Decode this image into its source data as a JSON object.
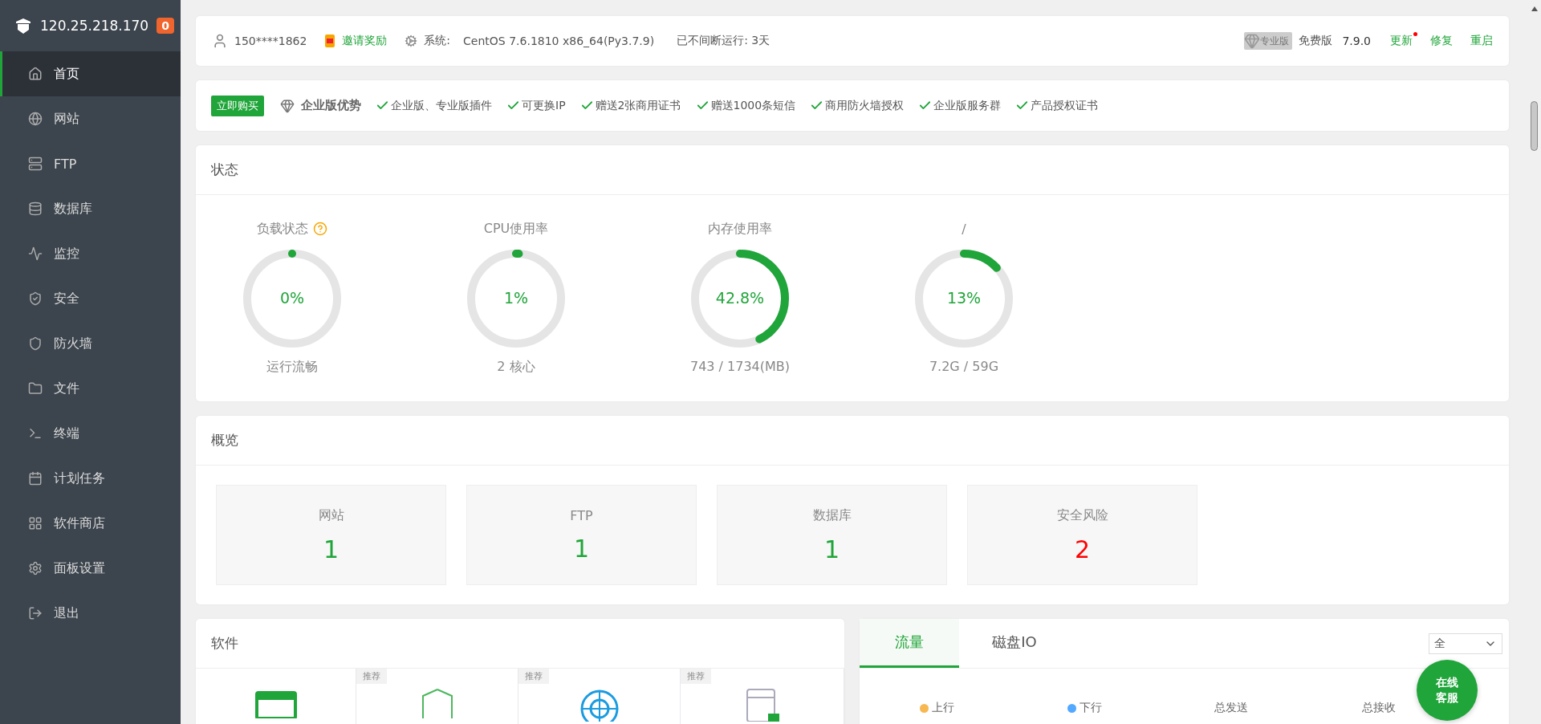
{
  "sidebar": {
    "host": "120.25.218.170",
    "badge": "0",
    "items": [
      {
        "label": "首页",
        "selected": true
      },
      {
        "label": "网站",
        "selected": false
      },
      {
        "label": "FTP",
        "selected": false
      },
      {
        "label": "数据库",
        "selected": false
      },
      {
        "label": "监控",
        "selected": false
      },
      {
        "label": "安全",
        "selected": false
      },
      {
        "label": "防火墙",
        "selected": false
      },
      {
        "label": "文件",
        "selected": false
      },
      {
        "label": "终端",
        "selected": false
      },
      {
        "label": "计划任务",
        "selected": false
      },
      {
        "label": "软件商店",
        "selected": false
      },
      {
        "label": "面板设置",
        "selected": false
      },
      {
        "label": "退出",
        "selected": false
      }
    ]
  },
  "topbar": {
    "user": "150****1862",
    "invite": "邀请奖励",
    "system_label": "系统:",
    "system": "CentOS 7.6.1810 x86_64(Py3.7.9)",
    "uptime": "已不间断运行: 3天",
    "pro_badge": "专业版",
    "edition": "免费版",
    "version": "7.9.0",
    "links": [
      {
        "label": "更新",
        "notification": true
      },
      {
        "label": "修复",
        "notification": false
      },
      {
        "label": "重启",
        "notification": false
      }
    ]
  },
  "promo": {
    "buy_button": "立即购买",
    "title": "企业版优势",
    "features": [
      "企业版、专业版插件",
      "可更换IP",
      "赠送2张商用证书",
      "赠送1000条短信",
      "商用防火墙授权",
      "企业版服务群",
      "产品授权证书"
    ]
  },
  "status": {
    "title": "状态",
    "gauges": [
      {
        "label": "负载状态",
        "help": true,
        "value": "0%",
        "level": 0,
        "caption": "运行流畅"
      },
      {
        "label": "CPU使用率",
        "help": false,
        "value": "1%",
        "level": 0.01,
        "caption": "2 核心"
      },
      {
        "label": "内存使用率",
        "help": false,
        "value": "42.8%",
        "level": 0.428,
        "caption": "743 / 1734(MB)"
      },
      {
        "label": "/",
        "help": false,
        "value": "13%",
        "level": 0.13,
        "caption": "7.2G / 59G"
      }
    ]
  },
  "overview": {
    "title": "概览",
    "items": [
      {
        "label": "网站",
        "value": "1",
        "color": "#20a53a"
      },
      {
        "label": "FTP",
        "value": "1",
        "color": "#20a53a"
      },
      {
        "label": "数据库",
        "value": "1",
        "color": "#20a53a"
      },
      {
        "label": "安全风险",
        "value": "2",
        "color": "#ff0000"
      }
    ]
  },
  "software": {
    "title": "软件",
    "tiles": [
      {
        "kind": "site"
      },
      {
        "tag": "推荐",
        "kind": "waf"
      },
      {
        "tag": "推荐",
        "kind": "scan"
      },
      {
        "tag": "推荐",
        "kind": "lock"
      }
    ]
  },
  "traffic": {
    "tabs": [
      {
        "label": "流量",
        "selected": true
      },
      {
        "label": "磁盘IO",
        "selected": false
      }
    ],
    "select": "全",
    "legend": [
      {
        "label": "上行",
        "color": "#f7b851"
      },
      {
        "label": "下行",
        "color": "#52a9ff"
      },
      {
        "label": "总发送"
      },
      {
        "label": "总接收"
      }
    ]
  },
  "chat_button": "在线客服"
}
